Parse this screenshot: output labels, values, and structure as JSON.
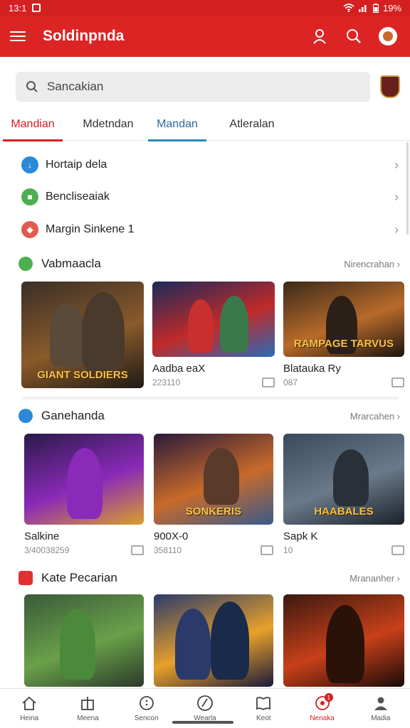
{
  "status_bar": {
    "time": "13:1",
    "battery": "19%"
  },
  "app_bar": {
    "title": "Soldinpnda"
  },
  "search": {
    "placeholder": "Sancakian"
  },
  "tabs": [
    {
      "label": "Mandian",
      "state": "active-red"
    },
    {
      "label": "Mdetndan",
      "state": ""
    },
    {
      "label": "Mandan",
      "state": "active-blue"
    },
    {
      "label": "Atleralan",
      "state": ""
    }
  ],
  "menu_items": [
    {
      "label": "Hortaip dela",
      "icon": "download-icon",
      "color": "#2a8ad8"
    },
    {
      "label": "Bencliseaiak",
      "icon": "gamepad-icon",
      "color": "#4caf50"
    },
    {
      "label": "Margin Sinkene 1",
      "icon": "ticket-icon",
      "color": "#e35b4f"
    }
  ],
  "sections": [
    {
      "title": "Vabmaacla",
      "more": "Nirencrahan",
      "dot_color": "#4caf50",
      "cards": [
        {
          "title": "",
          "meta": "",
          "thumb_text": "GIANT SOLDIERS",
          "colors": [
            "#3a2f28",
            "#8a5a2a",
            "#1e1a16"
          ]
        },
        {
          "title": "Aadba eaX",
          "meta": "223110",
          "thumb_text": "",
          "colors": [
            "#1a2a5a",
            "#c02a2a",
            "#2a6ab8"
          ]
        },
        {
          "title": "Blatauka Ry",
          "meta": "087",
          "thumb_text": "RAMPAGE TARVUS",
          "colors": [
            "#3a2a1a",
            "#b86a2a",
            "#1a1410"
          ]
        }
      ]
    },
    {
      "title": "Ganehanda",
      "more": "Mrarcahen",
      "dot_color": "#2a8ad8",
      "cards": [
        {
          "title": "Salkine",
          "meta": "3/40038259",
          "thumb_text": "",
          "colors": [
            "#2a1a4a",
            "#8a2ab8",
            "#d8a02a"
          ]
        },
        {
          "title": "900X-0",
          "meta": "358110",
          "thumb_text": "SONKERIS",
          "colors": [
            "#2a1a3a",
            "#c86a2a",
            "#3a5a8a"
          ]
        },
        {
          "title": "Sapk K",
          "meta": "10",
          "thumb_text": "HAABALES",
          "colors": [
            "#3a4a5a",
            "#6a7a8a",
            "#1a2028"
          ]
        }
      ]
    },
    {
      "title": "Kate Pecarian",
      "more": "Mrananher",
      "dot_color": "#e03030",
      "cards": [
        {
          "title": "",
          "meta": "",
          "thumb_text": "",
          "colors": [
            "#3a5a3a",
            "#6aa04a",
            "#2a3a2a"
          ]
        },
        {
          "title": "",
          "meta": "",
          "thumb_text": "",
          "colors": [
            "#2a3a6a",
            "#e8a02a",
            "#1a1a3a"
          ]
        },
        {
          "title": "",
          "meta": "",
          "thumb_text": "",
          "colors": [
            "#3a1a10",
            "#c8401a",
            "#1a0a08"
          ]
        }
      ]
    }
  ],
  "bottom_nav": [
    {
      "label": "Heina",
      "icon": "home-icon"
    },
    {
      "label": "Meena",
      "icon": "grid-icon"
    },
    {
      "label": "Sencon",
      "icon": "circle-dots-icon"
    },
    {
      "label": "Wearla",
      "icon": "compass-icon"
    },
    {
      "label": "Keot",
      "icon": "book-icon"
    },
    {
      "label": "Nenaka",
      "icon": "controller-icon",
      "active": true,
      "badge": "1"
    },
    {
      "label": "Madia",
      "icon": "person-icon"
    }
  ],
  "colors": {
    "primary": "#dd2424",
    "accent_blue": "#2a8ab8"
  }
}
